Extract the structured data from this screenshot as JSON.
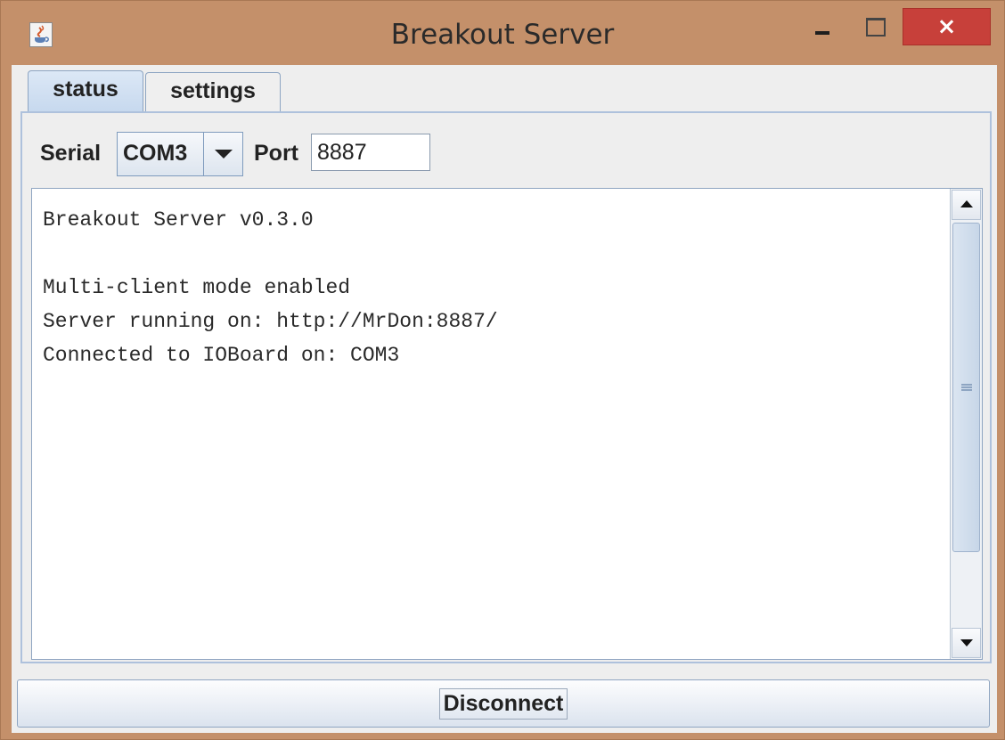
{
  "window": {
    "title": "Breakout Server",
    "close_glyph": "×"
  },
  "tabs": [
    {
      "label": "status",
      "selected": true
    },
    {
      "label": "settings",
      "selected": false
    }
  ],
  "serial": {
    "label": "Serial",
    "selected": "COM3"
  },
  "port": {
    "label": "Port",
    "value": "8887"
  },
  "log": {
    "lines": "Breakout Server v0.3.0\n\nMulti-client mode enabled\nServer running on: http://MrDon:8887/\nConnected to IOBoard on: COM3"
  },
  "actions": {
    "disconnect_label": "Disconnect"
  },
  "colors": {
    "frame": "#c4906a",
    "close_button": "#c7403a",
    "accent": "#aec1dc"
  },
  "icons": {
    "app": "java-cup-icon",
    "minimize": "minimize-icon",
    "maximize": "maximize-icon",
    "close": "close-icon",
    "dropdown": "chevron-down-icon",
    "scroll_up": "scroll-up-icon",
    "scroll_down": "scroll-down-icon"
  }
}
